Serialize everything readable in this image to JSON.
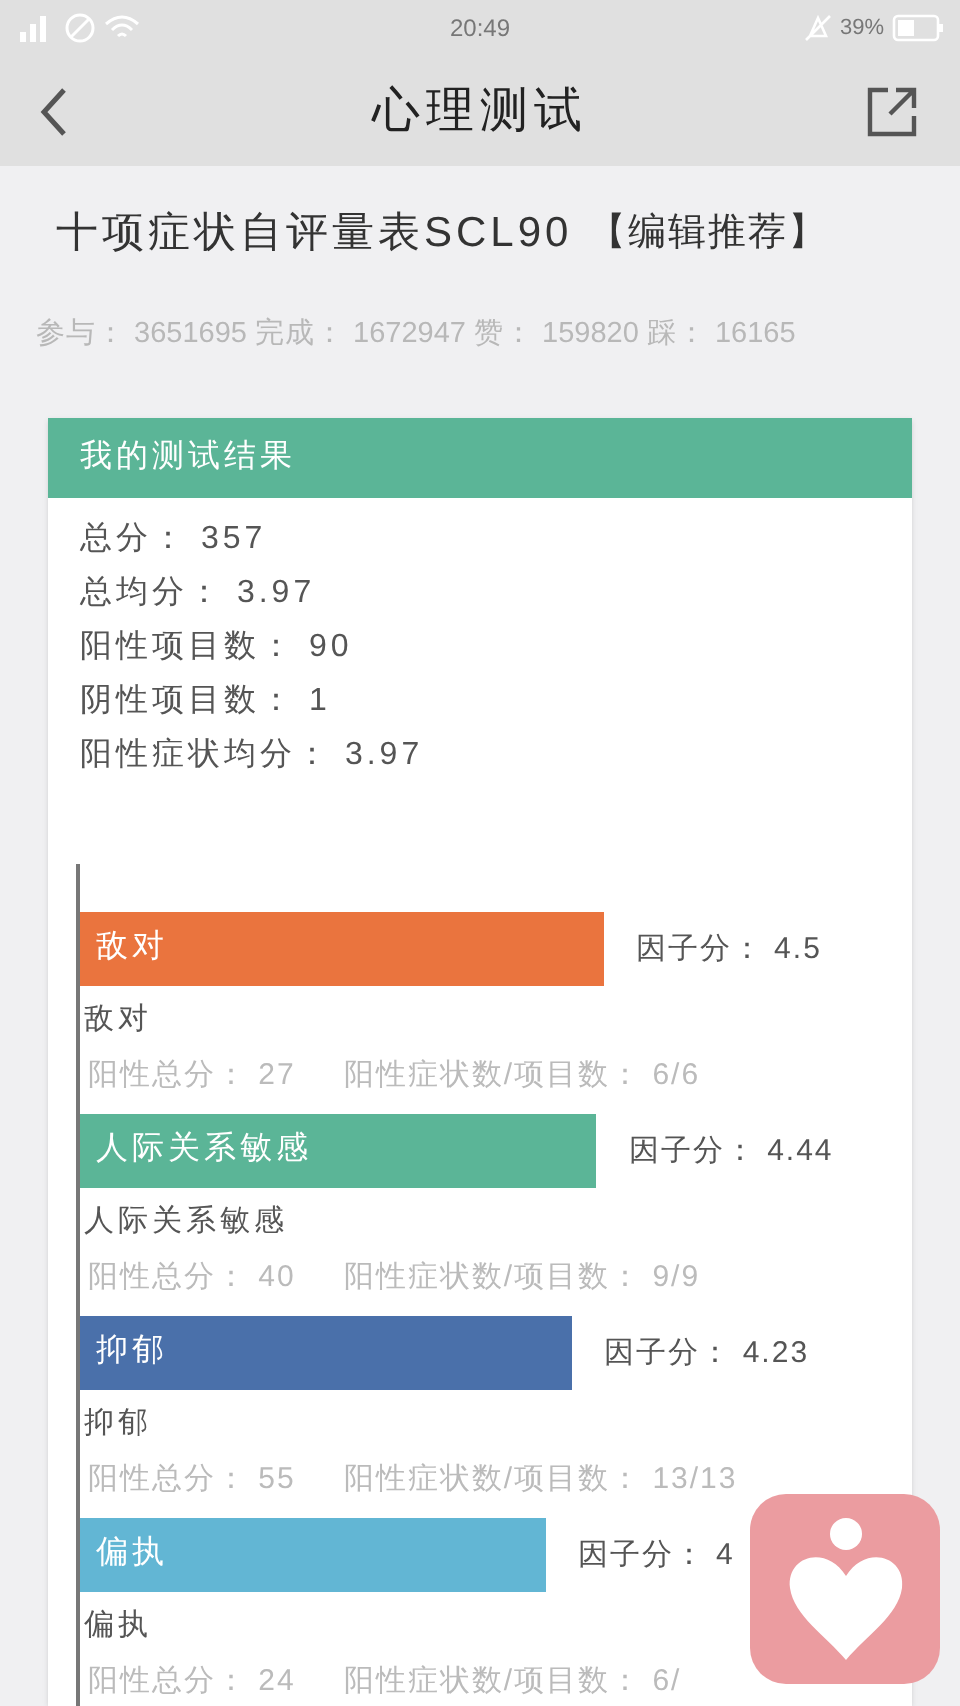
{
  "status_bar": {
    "time": "20:49",
    "battery": "39%"
  },
  "header": {
    "title": "心理测试"
  },
  "test": {
    "title": "十项症状自评量表SCL90",
    "tag": "【编辑推荐】",
    "stats": "参与： 3651695 完成： 1672947 赞： 159820 踩： 16165"
  },
  "result": {
    "heading": "我的测试结果",
    "summary": [
      "总分： 357",
      "总均分： 3.97",
      "阳性项目数： 90",
      "阴性项目数： 1",
      "阳性症状均分： 3.97"
    ],
    "factors": [
      {
        "name": "敌对",
        "color": "#ea743e",
        "score_label": "因子分： 4.5",
        "detail_name": "敌对",
        "positive_total": "阳性总分： 27",
        "positive_count": "阳性症状数/项目数： 6/6"
      },
      {
        "name": "人际关系敏感",
        "color": "#5bb597",
        "score_label": "因子分： 4.44",
        "detail_name": "人际关系敏感",
        "positive_total": "阳性总分： 40",
        "positive_count": "阳性症状数/项目数： 9/9"
      },
      {
        "name": "抑郁",
        "color": "#4a70aa",
        "score_label": "因子分： 4.23",
        "detail_name": "抑郁",
        "positive_total": "阳性总分： 55",
        "positive_count": "阳性症状数/项目数： 13/13"
      },
      {
        "name": "偏执",
        "color": "#62b6d4",
        "score_label": "因子分： 4",
        "detail_name": "偏执",
        "positive_total": "阳性总分： 24",
        "positive_count": "阳性症状数/项目数： 6/"
      }
    ]
  }
}
